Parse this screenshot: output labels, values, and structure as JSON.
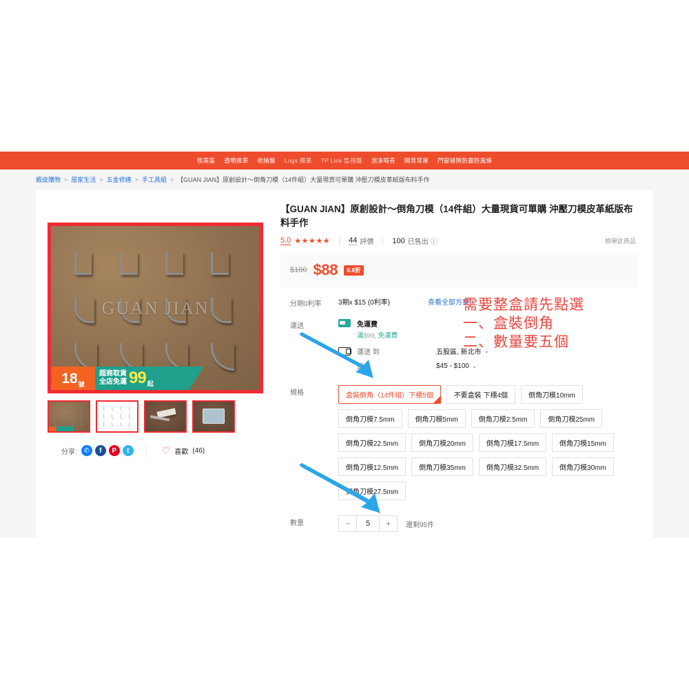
{
  "promo_bar": {
    "links": [
      {
        "label": "牧高笛",
        "dim": false
      },
      {
        "label": "透明推車",
        "dim": false
      },
      {
        "label": "收納盤",
        "dim": false
      },
      {
        "label": "Logs 推車",
        "dim": true
      },
      {
        "label": "TP Link 監視器",
        "dim": true
      },
      {
        "label": "泡沫噴壺",
        "dim": false
      },
      {
        "label": "隔音耳塞",
        "dim": false
      },
      {
        "label": "門窗縫隙防塵防風條",
        "dim": false
      }
    ]
  },
  "breadcrumb": {
    "items": [
      "蝦皮購物",
      "居家生活",
      "五金修繕",
      "手工具組"
    ],
    "current": "【GUAN JIAN】原創設計〜倒角刀模（14件組）大量現貨可單購 沖壓刀模皮革紙版布料手作",
    "separator": ">"
  },
  "gallery": {
    "watermark": "GUAN JIAN",
    "banner": {
      "day_number": "18",
      "day_unit": "號",
      "line1": "超商取貨",
      "line2": "全店免運",
      "amount": "99",
      "suffix": "起"
    },
    "thumbnails": [
      {
        "name": "thumb-dies-photo"
      },
      {
        "name": "thumb-diagram"
      },
      {
        "name": "thumb-tool-photo"
      },
      {
        "name": "thumb-case-photo"
      }
    ]
  },
  "share": {
    "label": "分享:",
    "icons": [
      {
        "name": "messenger-icon",
        "glyph": "✆"
      },
      {
        "name": "facebook-icon",
        "glyph": "f"
      },
      {
        "name": "pinterest-icon",
        "glyph": "P"
      },
      {
        "name": "twitter-icon",
        "glyph": "t"
      }
    ],
    "like_label": "喜歡",
    "like_count": "(46)"
  },
  "product": {
    "title": "【GUAN JIAN】原創設計〜倒角刀模（14件組）大量現貨可單購 沖壓刀模皮革紙版布料手作",
    "rating": "5.0",
    "stars": "★★★★★",
    "review_count": "44",
    "review_label": "評價",
    "sold_count": "100",
    "sold_label": "已售出",
    "sold_info_icon": "ⓘ",
    "report_label": "檢舉此商品"
  },
  "price": {
    "original": "$100",
    "current": "$88",
    "discount_badge": "8.8折"
  },
  "installment": {
    "label": "分期0利率",
    "plan": "3期x $15 (0利率)",
    "link": "查看全部方案",
    "link_arrow": "›"
  },
  "shipping": {
    "label": "運送",
    "free_title": "免運費",
    "free_sub_prefix": "滿",
    "free_sub_amount": "$99",
    "free_sub_suffix": ", 免運費",
    "ship_to_label": "運送 到",
    "ship_to_value": "五股區, 新北市",
    "fee_label": "運費",
    "fee_value": "$45 - $100",
    "caret": "⌄"
  },
  "variation": {
    "label": "規格",
    "options": [
      {
        "label": "盒裝倒角（14件組）下標5個",
        "selected": true
      },
      {
        "label": "不要盒裝 下標4個",
        "selected": false
      },
      {
        "label": "倒角刀模10mm",
        "selected": false
      },
      {
        "label": "倒角刀模7.5mm",
        "selected": false
      },
      {
        "label": "倒角刀模5mm",
        "selected": false
      },
      {
        "label": "倒角刀模2.5mm",
        "selected": false
      },
      {
        "label": "倒角刀模25mm",
        "selected": false
      },
      {
        "label": "倒角刀模22.5mm",
        "selected": false
      },
      {
        "label": "倒角刀模20mm",
        "selected": false
      },
      {
        "label": "倒角刀模17.5mm",
        "selected": false
      },
      {
        "label": "倒角刀模15mm",
        "selected": false
      },
      {
        "label": "倒角刀模12.5mm",
        "selected": false
      },
      {
        "label": "倒角刀模35mm",
        "selected": false
      },
      {
        "label": "倒角刀模32.5mm",
        "selected": false
      },
      {
        "label": "倒角刀模30mm",
        "selected": false
      },
      {
        "label": "倒角刀模27.5mm",
        "selected": false
      }
    ]
  },
  "quantity": {
    "label": "數量",
    "decrement": "−",
    "value": "5",
    "increment": "+",
    "stock_text": "還剩95件"
  },
  "annotation": {
    "text": "需要整盒請先點選\n一、盒裝倒角\n二、數量要五個",
    "color": "#e8473f"
  },
  "colors": {
    "brand_orange": "#ee4d2d",
    "arrow_blue": "#2ba6e8",
    "link_blue": "#2673dd",
    "free_ship_green": "#26aa99",
    "annotation_red": "#e8473f"
  }
}
